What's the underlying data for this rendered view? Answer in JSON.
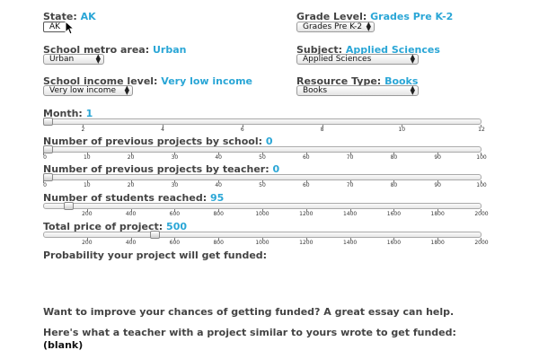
{
  "fields": {
    "state": {
      "label": "State:",
      "value": "AK",
      "selected": "AK"
    },
    "grade": {
      "label": "Grade Level:",
      "value": "Grades Pre K-2",
      "selected": "Grades Pre K-2"
    },
    "metro": {
      "label": "School metro area:",
      "value": "Urban",
      "selected": "Urban"
    },
    "subject": {
      "label": "Subject:",
      "value": "Applied Sciences",
      "selected": "Applied Sciences"
    },
    "income": {
      "label": "School income level:",
      "value": "Very low income",
      "selected": "Very low income"
    },
    "resource": {
      "label": "Resource Type:",
      "value": "Books",
      "selected": "Books"
    }
  },
  "sliders": {
    "month": {
      "label": "Month:",
      "value": "1",
      "min": 1,
      "max": 12,
      "current": 1,
      "ticks": [
        "2",
        "4",
        "6",
        "8",
        "10",
        "12"
      ]
    },
    "school_projects": {
      "label": "Number of previous projects by school:",
      "value": "0",
      "min": 0,
      "max": 100,
      "current": 0,
      "ticks": [
        "0",
        "10",
        "20",
        "30",
        "40",
        "50",
        "60",
        "70",
        "80",
        "90",
        "100"
      ]
    },
    "teacher_projects": {
      "label": "Number of previous projects by teacher:",
      "value": "0",
      "min": 0,
      "max": 100,
      "current": 0,
      "ticks": [
        "0",
        "10",
        "20",
        "30",
        "40",
        "50",
        "60",
        "70",
        "80",
        "90",
        "100"
      ]
    },
    "students": {
      "label": "Number of students reached:",
      "value": "95",
      "min": 0,
      "max": 2000,
      "current": 95,
      "ticks": [
        "200",
        "400",
        "600",
        "800",
        "1000",
        "1200",
        "1400",
        "1600",
        "1800",
        "2000"
      ]
    },
    "price": {
      "label": "Total price of project:",
      "value": "500",
      "min": 0,
      "max": 2000,
      "current": 500,
      "ticks": [
        "200",
        "400",
        "600",
        "800",
        "1000",
        "1200",
        "1400",
        "1600",
        "1800",
        "2000"
      ]
    }
  },
  "probability": {
    "label": "Probability your project will get funded:"
  },
  "improve_text": "Want to improve your chances of getting funded? A great essay can help.",
  "essay_heading": "Here's what a teacher with a project similar to yours wrote to get funded:",
  "essay_text": "(blank)"
}
